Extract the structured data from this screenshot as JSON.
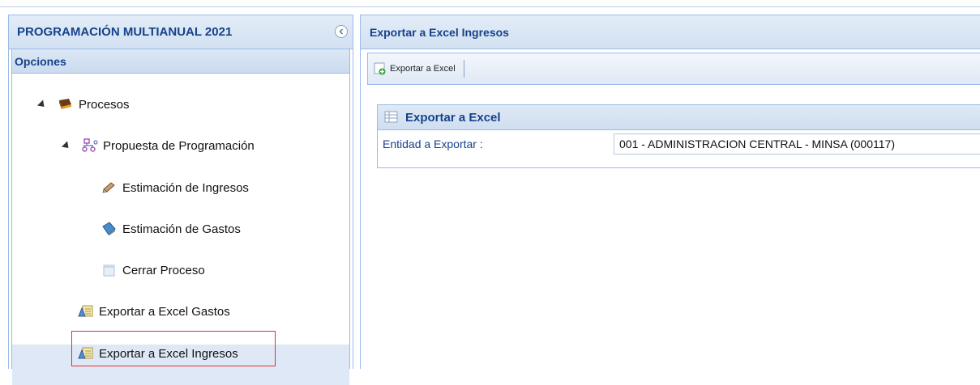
{
  "sidebar": {
    "title": "PROGRAMACIÓN MULTIANUAL 2021",
    "section_label": "Opciones",
    "tree": {
      "procesos": "Procesos",
      "propuesta": "Propuesta de Programación",
      "estimacion_ingresos": "Estimación de Ingresos",
      "estimacion_gastos": "Estimación de Gastos",
      "cerrar_proceso": "Cerrar Proceso",
      "exportar_gastos": "Exportar a Excel Gastos",
      "exportar_ingresos": "Exportar a Excel Ingresos"
    }
  },
  "main": {
    "title": "Exportar a Excel Ingresos",
    "toolbar": {
      "export_label": "Exportar a Excel"
    },
    "form": {
      "title": "Exportar a Excel",
      "field_label": "Entidad a Exportar :",
      "field_value": "001 - ADMINISTRACION CENTRAL - MINSA (000117)"
    }
  }
}
